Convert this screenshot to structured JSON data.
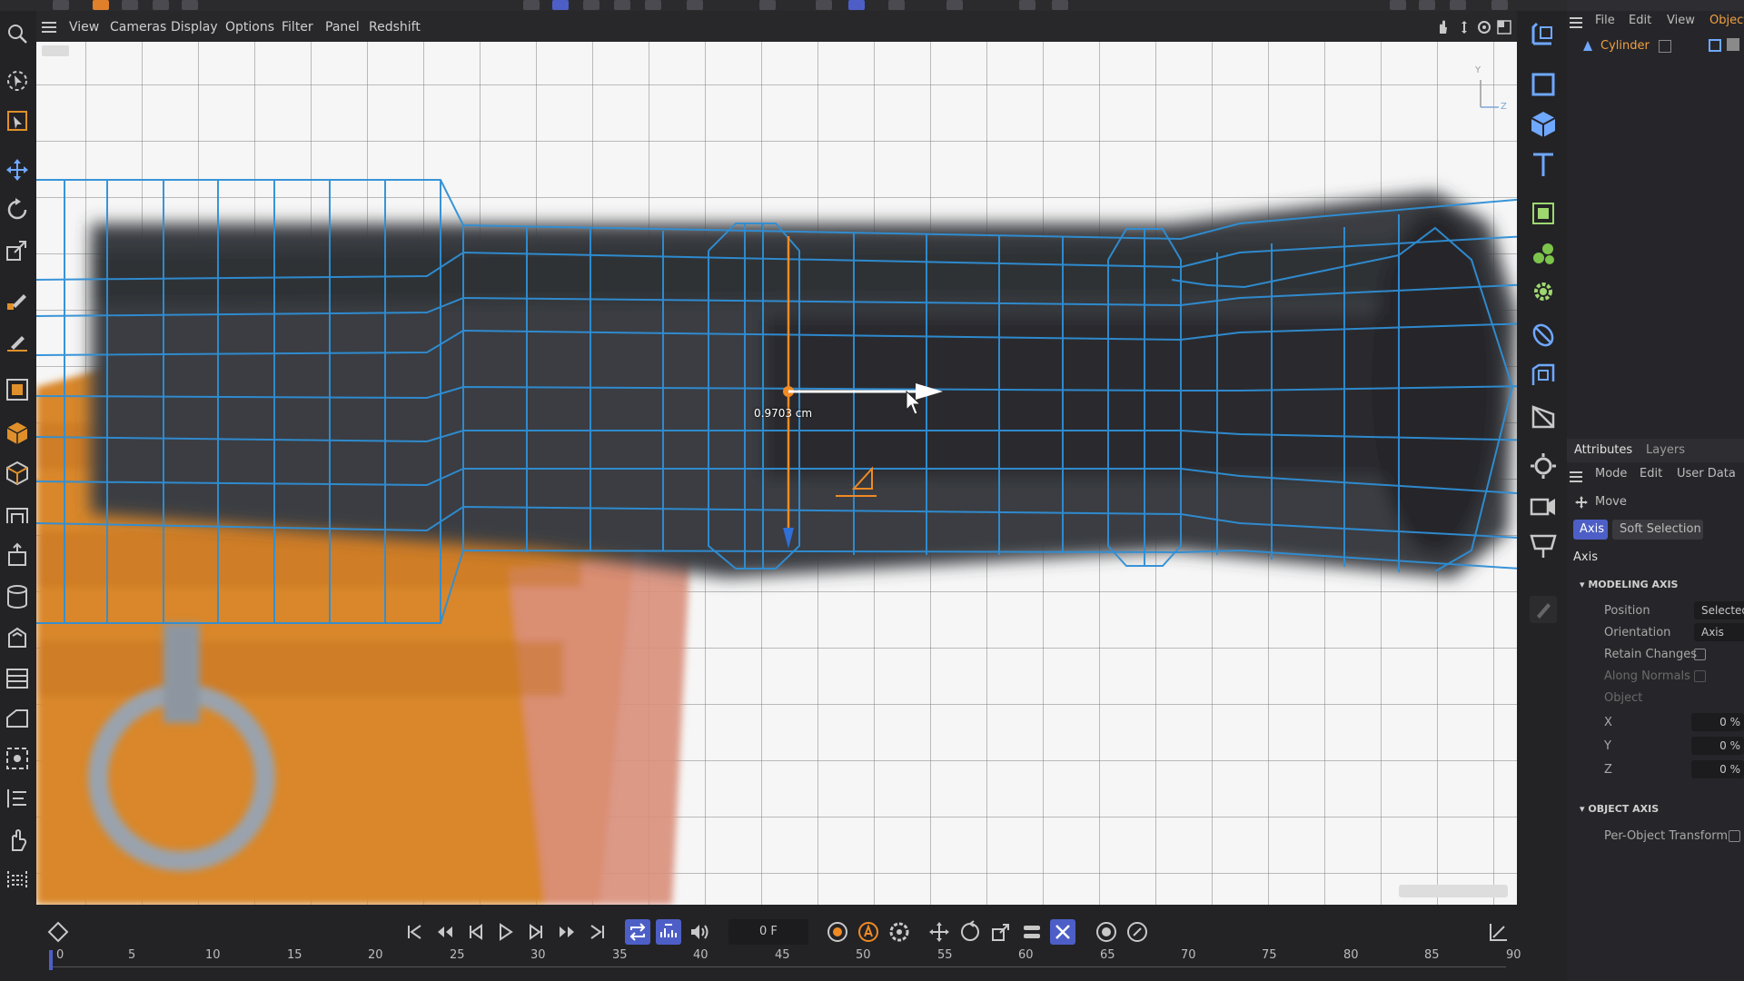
{
  "menubar": {
    "items": [
      "View",
      "Cameras",
      "Display",
      "Options",
      "Filter",
      "Panel",
      "Redshift"
    ]
  },
  "viewport": {
    "measurement": "0.9703 cm",
    "axis_labels": {
      "y": "Y",
      "z": "Z"
    }
  },
  "objects_panel": {
    "menu": [
      "File",
      "Edit",
      "View",
      "Object"
    ],
    "selected_object": "Cylinder"
  },
  "attributes": {
    "tabs": [
      "Attributes",
      "Layers"
    ],
    "menu": [
      "Mode",
      "Edit",
      "User Data"
    ],
    "tool_name": "Move",
    "subtabs": [
      "Axis",
      "Soft Selection"
    ],
    "section_title": "Axis",
    "modeling_axis": {
      "header": "MODELING AXIS",
      "position_label": "Position",
      "position_value": "Selected",
      "orientation_label": "Orientation",
      "orientation_value": "Axis",
      "retain_changes_label": "Retain Changes",
      "along_normals_label": "Along Normals",
      "object_label": "Object",
      "x_label": "X",
      "x_value": "0 %",
      "y_label": "Y",
      "y_value": "0 %",
      "z_label": "Z",
      "z_value": "0 %"
    },
    "object_axis": {
      "header": "OBJECT AXIS",
      "per_object_label": "Per-Object Transform"
    }
  },
  "timeline": {
    "frame_field": "0 F",
    "ticks": [
      "0",
      "5",
      "10",
      "15",
      "20",
      "25",
      "30",
      "35",
      "40",
      "45",
      "50",
      "55",
      "60",
      "65",
      "70",
      "75",
      "80",
      "85",
      "90"
    ]
  },
  "colors": {
    "accent": "#4d5fc7",
    "wire": "#2f8fd6",
    "highlight": "#f08a24"
  }
}
